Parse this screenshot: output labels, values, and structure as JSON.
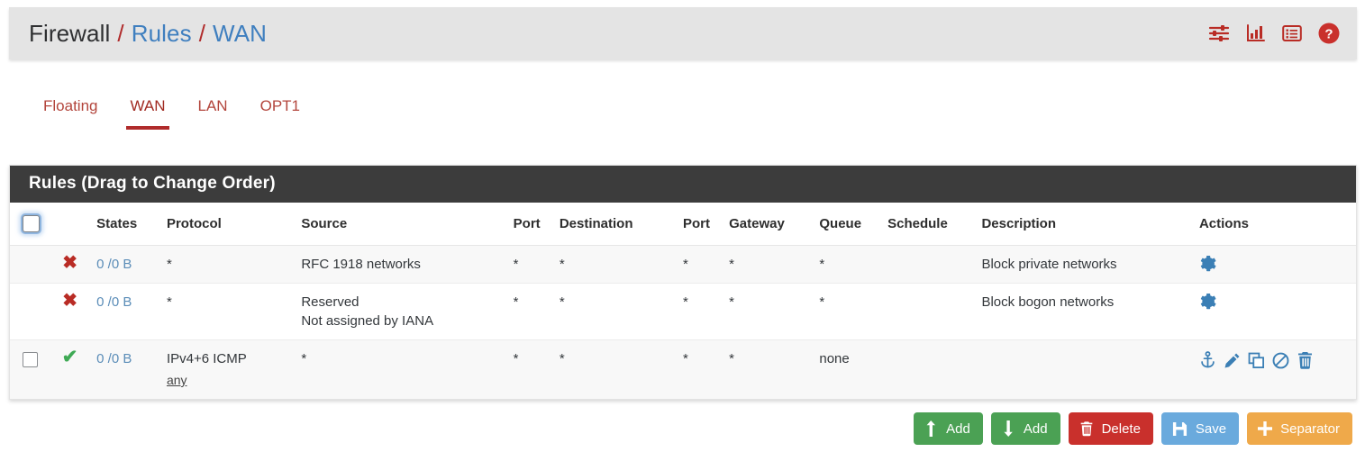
{
  "breadcrumb": {
    "root": "Firewall",
    "sep": "/",
    "section": "Rules",
    "page": "WAN"
  },
  "header_icons": [
    {
      "name": "sliders-icon",
      "label": "Advanced Filter"
    },
    {
      "name": "chart-icon",
      "label": "Traffic Graph"
    },
    {
      "name": "log-icon",
      "label": "Firewall Logs"
    },
    {
      "name": "help-icon",
      "label": "Help"
    }
  ],
  "tabs": [
    {
      "label": "Floating",
      "active": false
    },
    {
      "label": "WAN",
      "active": true
    },
    {
      "label": "LAN",
      "active": false
    },
    {
      "label": "OPT1",
      "active": false
    }
  ],
  "panel": {
    "title": "Rules (Drag to Change Order)",
    "columns": [
      "",
      "",
      "States",
      "Protocol",
      "Source",
      "Port",
      "Destination",
      "Port",
      "Gateway",
      "Queue",
      "Schedule",
      "Description",
      "Actions"
    ],
    "rows": [
      {
        "checkbox": false,
        "action_icon": "block-x-icon",
        "states": "0 /0 B",
        "protocol": "*",
        "protocol_sub": "",
        "source": "RFC 1918 networks",
        "source_sub": "",
        "port": "*",
        "destination": "*",
        "port2": "*",
        "gateway": "*",
        "queue": "*",
        "schedule": "",
        "description": "Block private networks",
        "actions": [
          "gear-icon"
        ]
      },
      {
        "checkbox": false,
        "action_icon": "block-x-icon",
        "states": "0 /0 B",
        "protocol": "*",
        "protocol_sub": "",
        "source": "Reserved",
        "source_sub": "Not assigned by IANA",
        "port": "*",
        "destination": "*",
        "port2": "*",
        "gateway": "*",
        "queue": "*",
        "schedule": "",
        "description": "Block bogon networks",
        "actions": [
          "gear-icon"
        ]
      },
      {
        "checkbox": true,
        "action_icon": "pass-check-icon",
        "states": "0 /0 B",
        "protocol": "IPv4+6 ICMP",
        "protocol_sub": "any",
        "source": "*",
        "source_sub": "",
        "port": "*",
        "destination": "*",
        "port2": "*",
        "gateway": "*",
        "queue": "none",
        "schedule": "",
        "description": "",
        "actions": [
          "anchor-icon",
          "edit-pencil-icon",
          "copy-icon",
          "disable-ban-icon",
          "delete-trash-icon"
        ]
      }
    ]
  },
  "buttons": [
    {
      "label": "Add",
      "icon": "arrow-up-icon",
      "color": "#4ba154"
    },
    {
      "label": "Add",
      "icon": "arrow-down-icon",
      "color": "#4ba154"
    },
    {
      "label": "Delete",
      "icon": "trash-icon",
      "color": "#c9302c"
    },
    {
      "label": "Save",
      "icon": "save-floppy-icon",
      "color": "#6aaadd"
    },
    {
      "label": "Separator",
      "icon": "plus-icon",
      "color": "#efa94a"
    }
  ],
  "colors": {
    "brand_red": "#b02b2b",
    "link_blue": "#3f7fbf",
    "panel_head": "#3c3c3c",
    "action_blue": "#3b7fb5",
    "block_red": "#b92c25",
    "pass_green": "#3faa55"
  }
}
